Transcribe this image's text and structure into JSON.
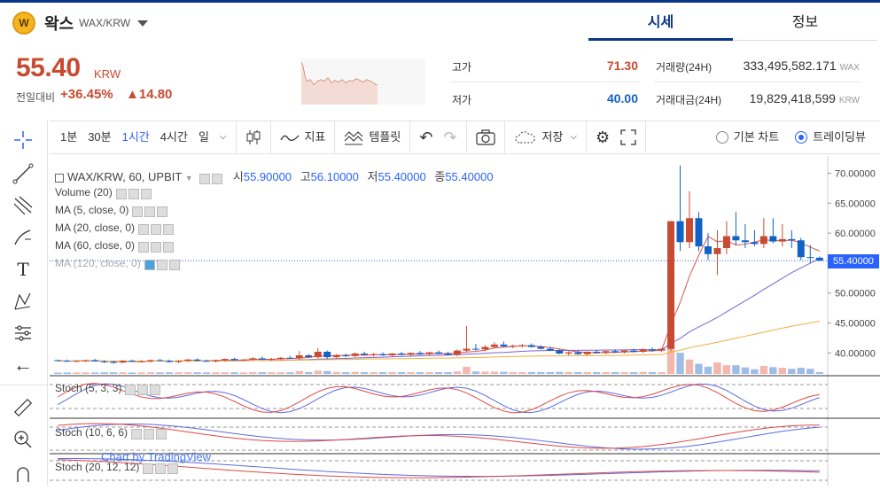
{
  "header": {
    "coin_logo_text": "W",
    "coin_name": "왁스",
    "pair": "WAX/KRW",
    "tabs": [
      {
        "label": "시세",
        "active": true
      },
      {
        "label": "정보",
        "active": false
      }
    ]
  },
  "ticker": {
    "price": "55.40",
    "unit": "KRW",
    "change_label": "전일대비",
    "change_rate": "+36.45%",
    "change_amount": "▲14.80",
    "high_label": "고가",
    "high_value": "71.30",
    "low_label": "저가",
    "low_value": "40.00",
    "volume_label": "거래량(24H)",
    "volume_value": "333,495,582.171",
    "volume_unit": "WAX",
    "amount_label": "거래대금(24H)",
    "amount_value": "19,829,418,599",
    "amount_unit": "KRW"
  },
  "toolbar": {
    "intervals": [
      {
        "label": "1분",
        "active": false
      },
      {
        "label": "30분",
        "active": false
      },
      {
        "label": "1시간",
        "active": true
      },
      {
        "label": "4시간",
        "active": false
      },
      {
        "label": "일",
        "active": false
      }
    ],
    "indicator_label": "지표",
    "template_label": "템플릿",
    "save_label": "저장",
    "basic_chart_label": "기본 차트",
    "tradingview_label": "트레이딩뷰",
    "selected_view": "tradingview"
  },
  "legend": {
    "symbol": "WAX/KRW, 60, UPBIT",
    "open_label": "시",
    "open": "55.90000",
    "high_label": "고",
    "high": "56.10000",
    "low_label": "저",
    "low": "55.40000",
    "close_label": "종",
    "close": "55.40000",
    "studies": [
      "Volume (20)",
      "MA (5, close, 0)",
      "MA (20, close, 0)",
      "MA (60, close, 0)",
      "MA (120, close, 0)"
    ],
    "stoch": [
      "Stoch (5, 3, 3)",
      "Stoch (10, 6, 6)",
      "Stoch (20, 12, 12)"
    ],
    "watermark": "Chart by TradingView"
  },
  "colors": {
    "up": "#c84a31",
    "down": "#1261c4",
    "accent": "#2962ff",
    "brand": "#093687"
  },
  "chart_data": {
    "type": "candlestick",
    "y_ticks": [
      "70.00000",
      "65.00000",
      "60.00000",
      "55.00000",
      "50.00000",
      "45.00000",
      "40.00000"
    ],
    "ylim": [
      36.5,
      72
    ],
    "last_price_label": "55.40000",
    "candles": [
      [
        38.8,
        38.9,
        38.6,
        38.7
      ],
      [
        38.7,
        38.9,
        38.5,
        38.6
      ],
      [
        38.6,
        38.8,
        38.4,
        38.7
      ],
      [
        38.7,
        38.9,
        38.5,
        38.8
      ],
      [
        38.8,
        39.0,
        38.6,
        38.6
      ],
      [
        38.6,
        38.8,
        38.3,
        38.5
      ],
      [
        38.5,
        38.7,
        38.2,
        38.4
      ],
      [
        38.4,
        38.8,
        38.3,
        38.7
      ],
      [
        38.7,
        38.9,
        38.5,
        38.6
      ],
      [
        38.6,
        38.8,
        38.4,
        38.6
      ],
      [
        38.6,
        38.9,
        38.4,
        38.8
      ],
      [
        38.8,
        39.0,
        38.6,
        38.7
      ],
      [
        38.7,
        38.9,
        38.4,
        38.5
      ],
      [
        38.5,
        38.8,
        38.3,
        38.7
      ],
      [
        38.7,
        39.0,
        38.5,
        38.9
      ],
      [
        38.9,
        39.1,
        38.6,
        38.7
      ],
      [
        38.7,
        38.9,
        38.5,
        38.6
      ],
      [
        38.6,
        38.9,
        38.4,
        38.8
      ],
      [
        38.8,
        39.1,
        38.6,
        39.0
      ],
      [
        39.0,
        39.2,
        38.7,
        38.8
      ],
      [
        38.8,
        39.0,
        38.6,
        38.9
      ],
      [
        38.9,
        39.3,
        38.7,
        39.1
      ],
      [
        39.1,
        39.4,
        38.8,
        38.9
      ],
      [
        38.9,
        39.2,
        38.7,
        39.0
      ],
      [
        39.0,
        39.3,
        38.8,
        39.2
      ],
      [
        39.2,
        39.5,
        39.0,
        39.1
      ],
      [
        39.1,
        40.3,
        38.9,
        39.6
      ],
      [
        39.6,
        39.8,
        39.2,
        39.3
      ],
      [
        39.3,
        40.8,
        39.1,
        40.2
      ],
      [
        40.2,
        40.4,
        39.0,
        39.3
      ],
      [
        39.3,
        39.8,
        39.1,
        39.6
      ],
      [
        39.6,
        39.9,
        39.3,
        39.5
      ],
      [
        39.5,
        40.1,
        39.3,
        39.9
      ],
      [
        39.9,
        40.2,
        39.6,
        39.7
      ],
      [
        39.7,
        40.0,
        39.4,
        39.8
      ],
      [
        39.8,
        40.1,
        39.5,
        39.6
      ],
      [
        39.6,
        40.0,
        39.4,
        39.9
      ],
      [
        39.9,
        40.2,
        39.6,
        39.7
      ],
      [
        39.7,
        40.1,
        39.5,
        40.0
      ],
      [
        40.0,
        40.3,
        39.7,
        39.8
      ],
      [
        39.8,
        40.2,
        39.6,
        40.1
      ],
      [
        40.1,
        40.4,
        39.8,
        39.9
      ],
      [
        39.9,
        40.2,
        39.6,
        39.7
      ],
      [
        39.7,
        40.6,
        39.5,
        40.4
      ],
      [
        40.4,
        44.5,
        40.1,
        40.7
      ],
      [
        40.7,
        41.5,
        40.4,
        40.6
      ],
      [
        40.6,
        41.3,
        40.3,
        41.0
      ],
      [
        41.0,
        41.8,
        40.8,
        41.4
      ],
      [
        41.4,
        41.9,
        41.0,
        41.1
      ],
      [
        41.1,
        41.4,
        40.8,
        41.2
      ],
      [
        41.2,
        41.5,
        40.9,
        41.3
      ],
      [
        41.3,
        41.6,
        40.9,
        41.0
      ],
      [
        41.0,
        41.3,
        40.6,
        40.7
      ],
      [
        40.7,
        41.0,
        40.3,
        40.4
      ],
      [
        40.4,
        40.6,
        39.8,
        39.9
      ],
      [
        39.9,
        40.3,
        39.6,
        40.1
      ],
      [
        40.1,
        40.4,
        39.7,
        39.8
      ],
      [
        39.8,
        40.3,
        39.6,
        40.2
      ],
      [
        40.2,
        40.5,
        39.9,
        40.0
      ],
      [
        40.0,
        40.4,
        39.8,
        40.3
      ],
      [
        40.3,
        40.6,
        40.0,
        40.1
      ],
      [
        40.1,
        40.5,
        39.9,
        40.4
      ],
      [
        40.4,
        40.7,
        40.1,
        40.2
      ],
      [
        40.2,
        40.8,
        40.0,
        40.6
      ],
      [
        40.6,
        40.9,
        40.2,
        40.4
      ],
      [
        40.4,
        40.8,
        40.2,
        40.7
      ],
      [
        40.7,
        62.0,
        40.3,
        62.0
      ],
      [
        62.0,
        71.3,
        57.0,
        58.5
      ],
      [
        58.5,
        67.0,
        57.5,
        62.5
      ],
      [
        62.5,
        63.5,
        57.0,
        57.8
      ],
      [
        57.8,
        60.0,
        55.5,
        56.5
      ],
      [
        56.5,
        60.5,
        53.0,
        57.5
      ],
      [
        57.5,
        62.0,
        56.5,
        59.5
      ],
      [
        59.5,
        63.5,
        58.0,
        58.8
      ],
      [
        58.8,
        61.5,
        57.5,
        58.5
      ],
      [
        58.5,
        60.5,
        57.8,
        58.2
      ],
      [
        58.2,
        62.5,
        57.5,
        59.5
      ],
      [
        59.5,
        62.5,
        58.3,
        58.6
      ],
      [
        58.6,
        61.5,
        57.8,
        59.0
      ],
      [
        59.0,
        60.5,
        57.5,
        58.8
      ],
      [
        58.8,
        59.2,
        55.5,
        56.0
      ],
      [
        56.0,
        58.0,
        55.0,
        55.9
      ],
      [
        55.9,
        56.1,
        55.4,
        55.4
      ]
    ]
  }
}
